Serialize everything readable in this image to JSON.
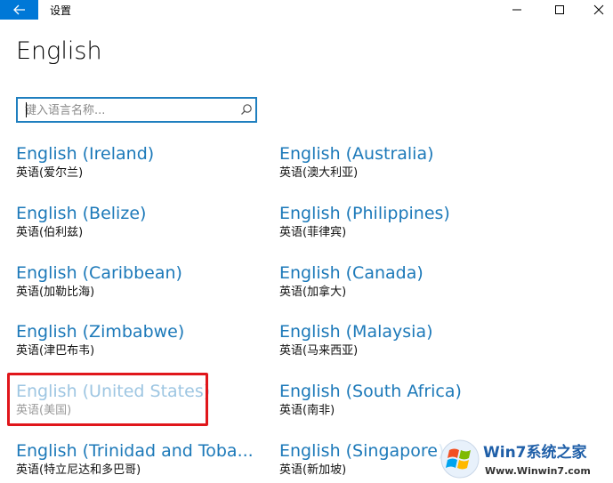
{
  "window": {
    "title": "设置"
  },
  "page": {
    "title": "English"
  },
  "search": {
    "placeholder": "键入语言名称..."
  },
  "languages": [
    {
      "name": "English (Ireland)",
      "local": "英语(爱尔兰)"
    },
    {
      "name": "English (Australia)",
      "local": "英语(澳大利亚)"
    },
    {
      "name": "English (Belize)",
      "local": "英语(伯利兹)"
    },
    {
      "name": "English (Philippines)",
      "local": "英语(菲律宾)"
    },
    {
      "name": "English (Caribbean)",
      "local": "英语(加勒比海)"
    },
    {
      "name": "English (Canada)",
      "local": "英语(加拿大)"
    },
    {
      "name": "English (Zimbabwe)",
      "local": "英语(津巴布韦)"
    },
    {
      "name": "English (Malaysia)",
      "local": "英语(马来西亚)"
    },
    {
      "name": "English (United States)",
      "local": "英语(美国)",
      "installed": true
    },
    {
      "name": "English (South Africa)",
      "local": "英语(南非)"
    },
    {
      "name": "English (Trinidad and Toba...",
      "local": "英语(特立尼达和多巴哥)"
    },
    {
      "name": "English (Singapore)",
      "local": "英语(新加坡)"
    }
  ],
  "watermark": {
    "brand": "Win7系统之家",
    "url": "Www.Winwin7.com"
  },
  "colors": {
    "accent": "#0078d7",
    "link": "#1c79b9",
    "highlight": "#e0161b"
  }
}
